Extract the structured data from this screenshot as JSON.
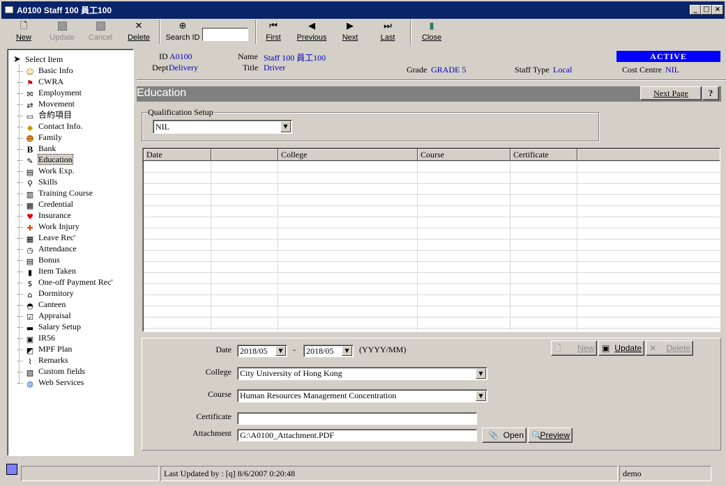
{
  "window": {
    "title": "A0100 Staff 100 員工100",
    "minimize": "_",
    "maximize": "□",
    "close": "×"
  },
  "toolbar": {
    "new": "New",
    "update": "Update",
    "cancel": "Cancel",
    "delete": "Delete",
    "search_id": "Search ID",
    "search_value": "",
    "first": "First",
    "previous": "Previous",
    "next": "Next",
    "last": "Last",
    "close": "Close"
  },
  "tree": {
    "root": "Select Item",
    "items": [
      {
        "label": "Basic Info",
        "icon": "person-icon"
      },
      {
        "label": "CWRA",
        "icon": "flag-icon"
      },
      {
        "label": "Employment",
        "icon": "envelope-icon"
      },
      {
        "label": "Movement",
        "icon": "transfer-icon"
      },
      {
        "label": "合約項目",
        "icon": "folder-icon"
      },
      {
        "label": "Contact Info.",
        "icon": "contact-icon"
      },
      {
        "label": "Family",
        "icon": "family-icon"
      },
      {
        "label": "Bank",
        "icon": "bank-icon"
      },
      {
        "label": "Education",
        "icon": "education-icon"
      },
      {
        "label": "Work Exp.",
        "icon": "document-icon"
      },
      {
        "label": "Skills",
        "icon": "wrench-icon"
      },
      {
        "label": "Training Course",
        "icon": "training-icon"
      },
      {
        "label": "Credential",
        "icon": "credential-icon"
      },
      {
        "label": "Insurance",
        "icon": "heart-icon"
      },
      {
        "label": "Work Injury",
        "icon": "cross-icon"
      },
      {
        "label": "Leave Rec'",
        "icon": "calendar-icon"
      },
      {
        "label": "Attendance",
        "icon": "clock-icon"
      },
      {
        "label": "Bonus",
        "icon": "bonus-icon"
      },
      {
        "label": "Item Taken",
        "icon": "item-icon"
      },
      {
        "label": "One-off Payment Rec'",
        "icon": "dollar-icon"
      },
      {
        "label": "Dormitory",
        "icon": "house-icon"
      },
      {
        "label": "Canteen",
        "icon": "canteen-icon"
      },
      {
        "label": "Appraisal",
        "icon": "checklist-icon"
      },
      {
        "label": "Salary Setup",
        "icon": "salary-icon"
      },
      {
        "label": "IR56",
        "icon": "disk-icon"
      },
      {
        "label": "MPF Plan",
        "icon": "chart-icon"
      },
      {
        "label": "Remarks",
        "icon": "paperclip-icon"
      },
      {
        "label": "Custom fields",
        "icon": "custom-icon"
      },
      {
        "label": "Web Services",
        "icon": "globe-icon"
      }
    ],
    "selected_index": 8
  },
  "info": {
    "id_label": "ID",
    "id_value": "A0100",
    "dept_label": "Dept",
    "dept_value": "Delivery",
    "name_label": "Name",
    "name_value": "Staff 100 員工100",
    "title_label": "Title",
    "title_value": "Driver",
    "grade_label": "Grade",
    "grade_value": "GRADE 5",
    "staff_type_label": "Staff Type",
    "staff_type_value": "Local",
    "cost_centre_label": "Cost Centre",
    "cost_centre_value": "NIL",
    "status": "ACTIVE"
  },
  "section": {
    "title": "Education",
    "next_page": "Next Page",
    "help": "?"
  },
  "qualification": {
    "legend": "Qualification Setup",
    "value": "NIL"
  },
  "grid": {
    "columns": [
      "Date",
      "",
      "College",
      "Course",
      "Certificate",
      ""
    ],
    "rows": []
  },
  "form": {
    "date_label": "Date",
    "date_from": "2018/05",
    "date_sep": "-",
    "date_to": "2018/05",
    "date_hint": "(YYYY/MM)",
    "college_label": "College",
    "college_value": "City University of Hong Kong",
    "course_label": "Course",
    "course_value": "Human Resources Management Concentration",
    "certificate_label": "Certificate",
    "certificate_value": "",
    "attachment_label": "Attachment",
    "attachment_value": "G:\\A0100_Attachment.PDF",
    "new_btn": "New",
    "update_btn": "Update",
    "delete_btn": "Delete",
    "open_btn": "Open",
    "preview_btn": "Preview"
  },
  "statusbar": {
    "cell1": "",
    "last_updated": "Last Updated by : [q]  8/6/2007 0:20:48",
    "user": "demo"
  }
}
